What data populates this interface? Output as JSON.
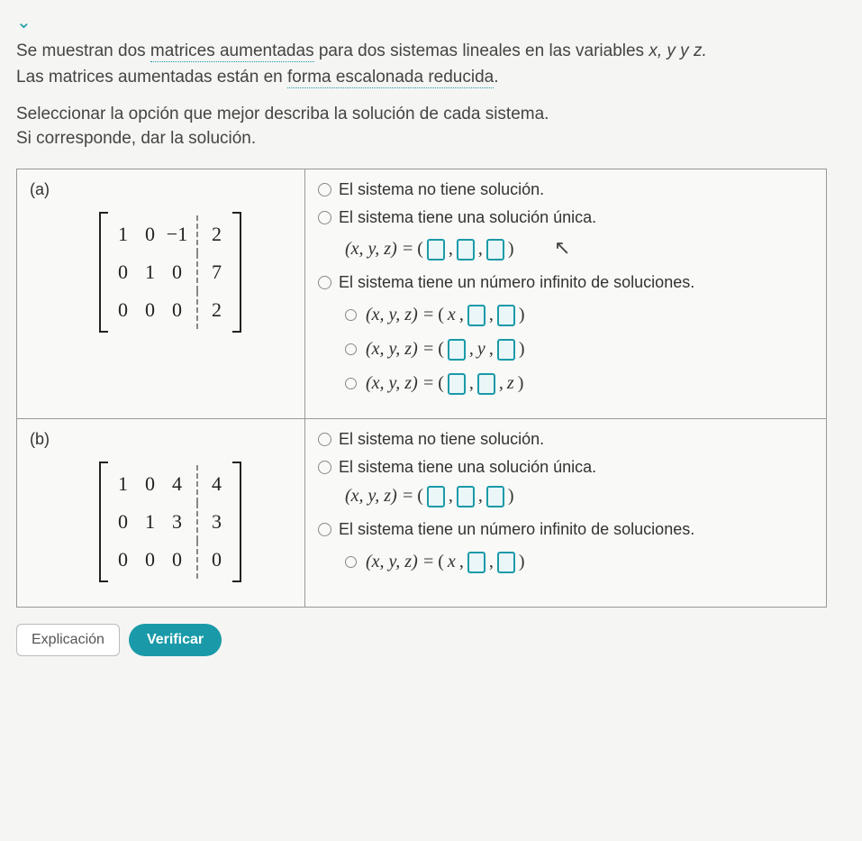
{
  "chevron_glyph": "⌄",
  "intro_pre": "Se muestran dos ",
  "intro_link1": "matrices aumentadas",
  "intro_mid": " para dos sistemas lineales en las variables ",
  "intro_vars": "x, y y z.",
  "intro2_pre": "Las matrices aumentadas están en ",
  "intro_link2": "forma escalonada reducida",
  "intro2_post": ".",
  "instr1": "Seleccionar la opción que mejor describa la solución de cada sistema.",
  "instr2": "Si corresponde, dar la solución.",
  "parts": {
    "a": {
      "label": "(a)",
      "matrix": {
        "r0": [
          "1",
          "0",
          "−1",
          "2"
        ],
        "r1": [
          "0",
          "1",
          "0",
          "7"
        ],
        "r2": [
          "0",
          "0",
          "0",
          "2"
        ]
      }
    },
    "b": {
      "label": "(b)",
      "matrix": {
        "r0": [
          "1",
          "0",
          "4",
          "4"
        ],
        "r1": [
          "0",
          "1",
          "3",
          "3"
        ],
        "r2": [
          "0",
          "0",
          "0",
          "0"
        ]
      }
    }
  },
  "opts": {
    "no_sol": "El sistema no tiene solución.",
    "unique": "El sistema tiene una solución única.",
    "infinite": "El sistema tiene un número infinito de soluciones.",
    "xyz_eq": "(x, y, z) =",
    "tuple_open": "(",
    "tuple_close": ")",
    "comma": ",",
    "var_x": "x",
    "var_y": "y",
    "var_z": "z"
  },
  "footer": {
    "explain": "Explicación",
    "verify": "Verificar"
  },
  "cursor": "↖"
}
